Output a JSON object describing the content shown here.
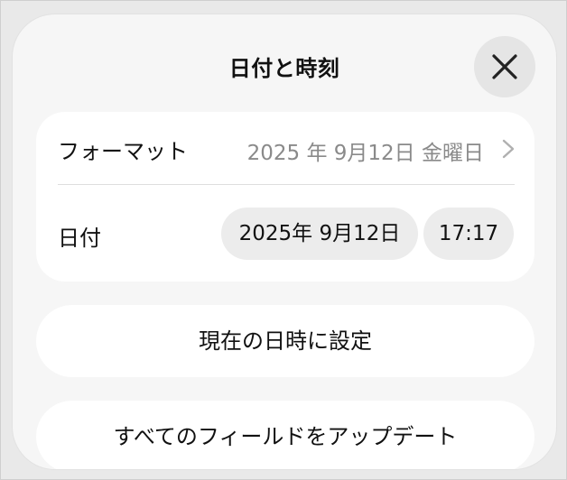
{
  "dialog": {
    "title": "日付と時刻",
    "close_icon": "close-x-icon"
  },
  "format_row": {
    "label": "フォーマット",
    "value": "2025 年 9月12日 金曜日",
    "chevron_icon": "chevron-right-icon"
  },
  "date_row": {
    "label": "日付",
    "date_value": "2025年 9月12日",
    "time_value": "17:17"
  },
  "buttons": {
    "set_now": "現在の日時に設定",
    "update_all": "すべてのフィールドをアップデート"
  },
  "colors": {
    "sheet_background": "#f6f6f6",
    "card_background": "#ffffff",
    "pill_background": "#ececec",
    "secondary_text": "#8a8a8a"
  }
}
